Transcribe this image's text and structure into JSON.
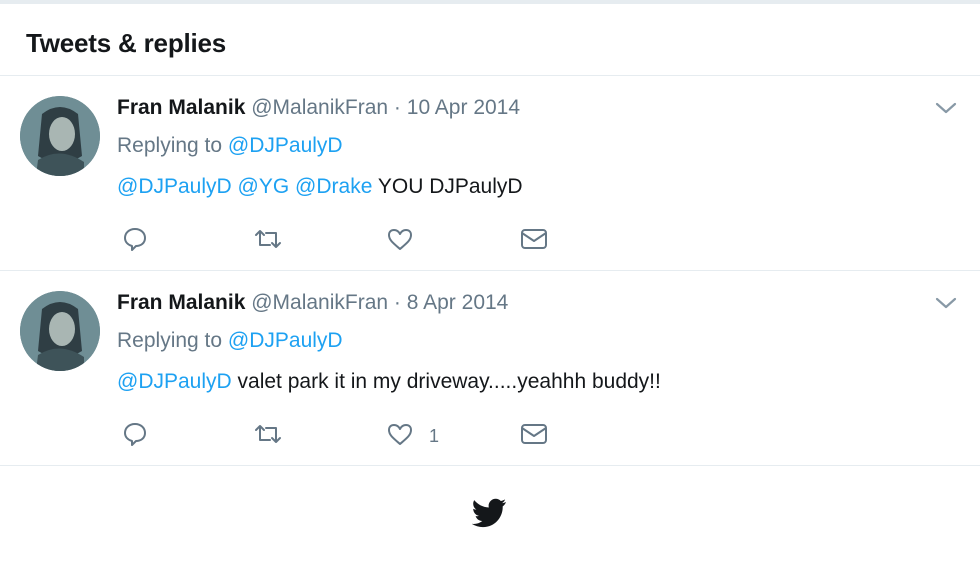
{
  "header": {
    "title": "Tweets & replies"
  },
  "tweets": [
    {
      "name": "Fran Malanik",
      "handle": "@MalanikFran",
      "separator": "·",
      "date": "10 Apr 2014",
      "replying_prefix": "Replying to",
      "replying_to": "@DJPaulyD",
      "mentions": [
        "@DJPaulyD",
        "@YG",
        "@Drake"
      ],
      "text": "YOU DJPaulyD",
      "like_count": ""
    },
    {
      "name": "Fran Malanik",
      "handle": "@MalanikFran",
      "separator": "·",
      "date": "8 Apr 2014",
      "replying_prefix": "Replying to",
      "replying_to": "@DJPaulyD",
      "mentions": [
        "@DJPaulyD"
      ],
      "text": "valet park it in my driveway.....yeahhh buddy!!",
      "like_count": "1"
    }
  ],
  "icons": {
    "reply": "reply-icon",
    "retweet": "retweet-icon",
    "like": "heart-icon",
    "dm": "envelope-icon",
    "caret": "chevron-down-icon",
    "footer": "twitter-bird-icon"
  },
  "colors": {
    "link": "#1da1f2",
    "muted": "#657786",
    "text": "#14171a",
    "divider": "#e6ecf0"
  }
}
